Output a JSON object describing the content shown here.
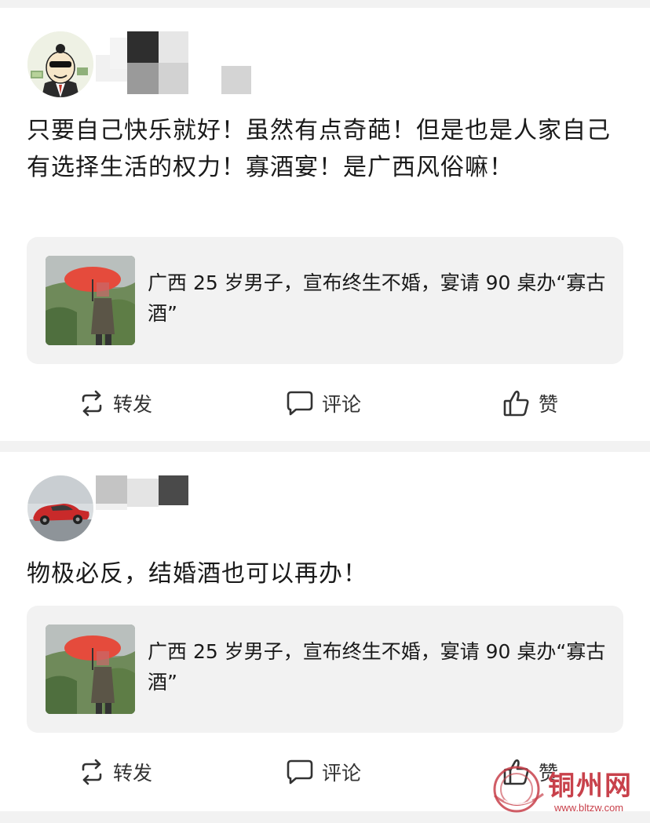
{
  "posts": [
    {
      "content": "只要自己快乐就好！虽然有点奇葩！但是也是人家自己有选择生活的权力！寡酒宴！是广西风俗嘛！",
      "link_card": {
        "title": "广西 25 岁男子，宣布终生不婚，宴请 90 桌办“寡古酒”"
      },
      "actions": {
        "repost": "转发",
        "comment": "评论",
        "like": "赞"
      }
    },
    {
      "content": "物极必反，结婚酒也可以再办！",
      "link_card": {
        "title": "广西 25 岁男子，宣布终生不婚，宴请 90 桌办“寡古酒”"
      },
      "actions": {
        "repost": "转发",
        "comment": "评论",
        "like": "赞"
      }
    }
  ],
  "watermark": {
    "name": "铜州网",
    "url": "www.bltzw.com"
  },
  "colors": {
    "card_bg": "#f2f2f2",
    "page_bg": "#f2f2f2",
    "watermark": "#c8414b"
  }
}
